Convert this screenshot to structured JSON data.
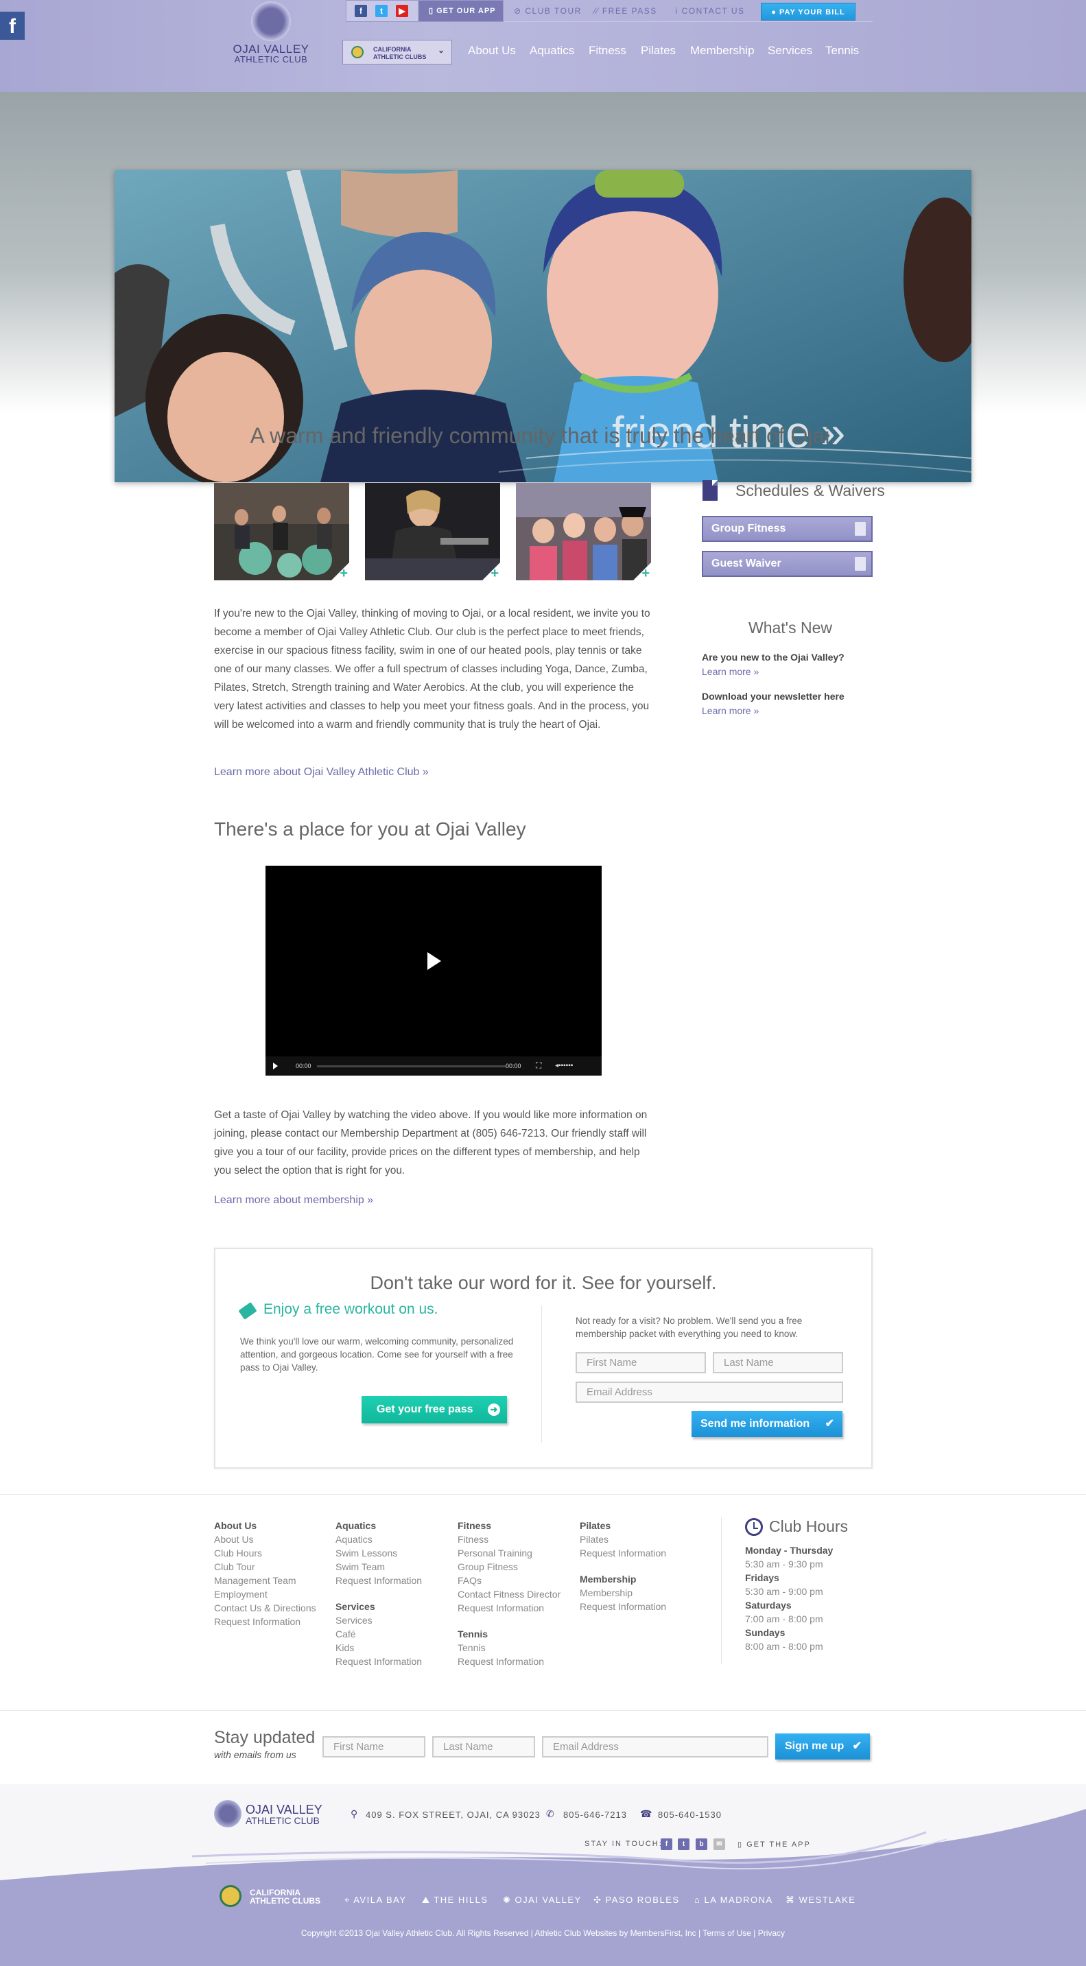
{
  "header": {
    "logo": {
      "line1": "OJAI VALLEY",
      "line2": "ATHLETIC CLUB"
    },
    "social": {
      "facebook": "f",
      "twitter": "t",
      "youtube": "▶"
    },
    "get_app": "GET OUR APP",
    "top_links": [
      "CLUB TOUR",
      "FREE PASS",
      "CONTACT US"
    ],
    "pay_bill": "PAY YOUR BILL",
    "cac_badge": {
      "line1": "CALIFORNIA",
      "line2": "ATHLETIC CLUBS"
    },
    "nav": [
      "About Us",
      "Aquatics",
      "Fitness",
      "Pilates",
      "Membership",
      "Services",
      "Tennis"
    ],
    "fb_tab": "f"
  },
  "hero": {
    "caption": "friend time »"
  },
  "tagline": "A warm and friendly community that is truly the heart of Ojai.",
  "intro": {
    "paragraph": "If you're new to the Ojai Valley, thinking of moving to Ojai, or a local resident, we invite you to become a member of Ojai Valley Athletic Club. Our club is the perfect place to meet friends, exercise in our spacious fitness facility, swim in one of our heated pools, play tennis or take one of our many classes. We offer a full spectrum of classes including Yoga, Dance, Zumba, Pilates, Stretch, Strength training and Water Aerobics. At the club, you will experience the very latest activities and classes to help you meet your fitness goals. And in the process, you will be welcomed into a warm and friendly community that is truly the heart of Ojai.",
    "learn_more": "Learn more about Ojai Valley Athletic Club »"
  },
  "place": {
    "heading": "There's a place for you at Ojai Valley",
    "video": {
      "time_start": "00:00",
      "time_end": "00:00"
    },
    "paragraph": "Get a taste of Ojai Valley by watching the video above. If you would like more information on joining, please contact our Membership Department at (805) 646-7213. Our friendly staff will give you a tour of our facility, provide prices on the different types of membership, and help you select the option that is right for you.",
    "learn_more": "Learn more about membership »"
  },
  "sidebar": {
    "schedules_heading": "Schedules & Waivers",
    "buttons": [
      "Group Fitness",
      "Guest Waiver"
    ],
    "whats_new_heading": "What's New",
    "items": [
      {
        "q": "Are you new to the Ojai Valley?",
        "link": "Learn more »"
      },
      {
        "q": "Download your newsletter here",
        "link": "Learn more »"
      }
    ]
  },
  "cta": {
    "heading": "Don't take our word for it. See for yourself.",
    "sub": "Enjoy a free workout on us.",
    "paragraph": "We think you'll love our warm, welcoming community, personalized attention, and gorgeous location. Come see for yourself with a free pass to Ojai Valley.",
    "free_pass_button": "Get your free pass",
    "right_text": "Not ready for a visit? No problem. We'll send you a free membership packet with everything you need to know.",
    "first_name": "First Name",
    "last_name": "Last Name",
    "email": "Email Address",
    "send_button": "Send me information"
  },
  "footer_nav": {
    "about": {
      "title": "About Us",
      "links": [
        "About Us",
        "Club Hours",
        "Club Tour",
        "Management Team",
        "Employment",
        "Contact Us & Directions",
        "Request Information"
      ]
    },
    "aquatics": {
      "title": "Aquatics",
      "links": [
        "Aquatics",
        "Swim Lessons",
        "Swim Team",
        "Request Information"
      ]
    },
    "services": {
      "title": "Services",
      "links": [
        "Services",
        "Café",
        "Kids",
        "Request Information"
      ]
    },
    "fitness": {
      "title": "Fitness",
      "links": [
        "Fitness",
        "Personal Training",
        "Group Fitness",
        "FAQs",
        "Contact Fitness Director",
        "Request Information"
      ]
    },
    "tennis": {
      "title": "Tennis",
      "links": [
        "Tennis",
        "Request Information"
      ]
    },
    "pilates": {
      "title": "Pilates",
      "links": [
        "Pilates",
        "Request Information"
      ]
    },
    "membership": {
      "title": "Membership",
      "links": [
        "Membership",
        "Request Information"
      ]
    },
    "hours": {
      "title": "Club Hours",
      "rows": [
        {
          "day": "Monday - Thursday",
          "time": "5:30 am - 9:30 pm"
        },
        {
          "day": "Fridays",
          "time": "5:30 am - 9:00 pm"
        },
        {
          "day": "Saturdays",
          "time": "7:00 am - 8:00 pm"
        },
        {
          "day": "Sundays",
          "time": "8:00 am - 8:00 pm"
        }
      ]
    }
  },
  "stay": {
    "heading": "Stay updated",
    "sub": "with emails from us",
    "first_name": "First Name",
    "last_name": "Last Name",
    "email": "Email Address",
    "button": "Sign me up"
  },
  "bottom": {
    "logo": {
      "line1": "OJAI VALLEY",
      "line2": "ATHLETIC CLUB"
    },
    "address": "409 S. FOX STREET, OJAI, CA 93023",
    "phone": "805-646-7213",
    "fax": "805-640-1530",
    "stay_in_touch": "STAY IN TOUCH:",
    "get_app": "GET THE APP",
    "cac": {
      "line1": "CALIFORNIA",
      "line2": "ATHLETIC CLUBS"
    },
    "locations": [
      "AVILA BAY",
      "THE HILLS",
      "OJAI VALLEY",
      "PASO ROBLES",
      "LA MADRONA",
      "WESTLAKE"
    ],
    "copyright": "Copyright ©2013 Ojai Valley Athletic Club. All Rights Reserved  |  Athletic Club Websites by MembersFirst, Inc  |  Terms of Use  |  Privacy"
  }
}
